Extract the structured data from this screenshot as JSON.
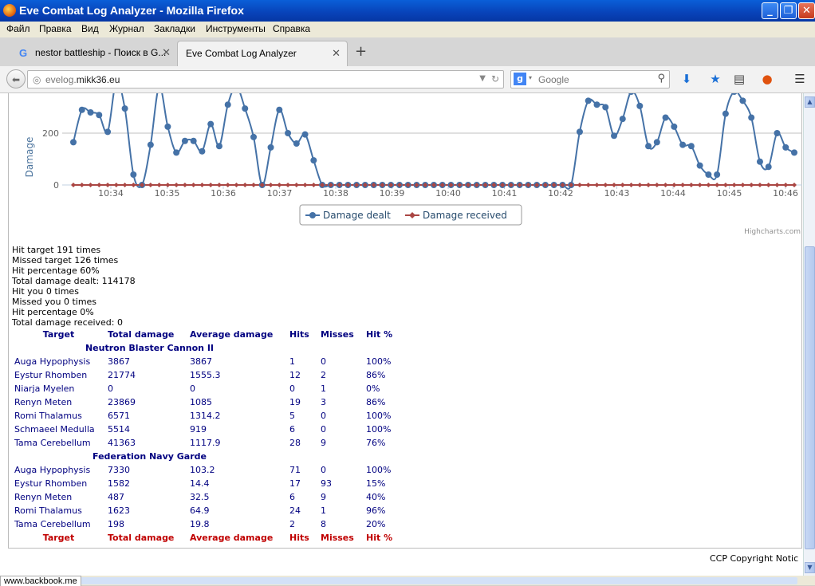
{
  "window": {
    "title": "Eve Combat Log Analyzer - Mozilla Firefox"
  },
  "menu": [
    "Файл",
    "Правка",
    "Вид",
    "Журнал",
    "Закладки",
    "Инструменты",
    "Справка"
  ],
  "tabs": [
    {
      "label": "nestor battleship - Поиск в G...",
      "icon": "google-g-icon"
    },
    {
      "label": "Eve Combat Log Analyzer"
    }
  ],
  "nav": {
    "url_prefix": "evelog.",
    "url_domain": "mikk36.eu",
    "search_placeholder": "Google"
  },
  "chart": {
    "axis_label": "Damage",
    "credits": "Highcharts.com",
    "legend": [
      "Damage dealt",
      "Damage received"
    ]
  },
  "chart_data": {
    "type": "line",
    "ylabel": "Damage",
    "y_ticks": [
      0,
      200
    ],
    "x_ticks": [
      "10:34",
      "10:35",
      "10:36",
      "10:37",
      "10:38",
      "10:39",
      "10:40",
      "10:41",
      "10:42",
      "10:43",
      "10:44",
      "10:45",
      "10:46"
    ],
    "series": [
      {
        "name": "Damage dealt",
        "color": "#4572A7",
        "values": [
          165,
          290,
          280,
          270,
          205,
          400,
          295,
          40,
          0,
          155,
          380,
          225,
          125,
          170,
          170,
          130,
          235,
          150,
          310,
          380,
          295,
          185,
          0,
          145,
          290,
          200,
          160,
          195,
          95,
          0,
          0,
          0,
          0,
          0,
          0,
          0,
          0,
          0,
          0,
          0,
          0,
          0,
          0,
          0,
          0,
          0,
          0,
          0,
          0,
          0,
          0,
          0,
          0,
          0,
          0,
          0,
          0,
          0,
          0,
          205,
          325,
          310,
          300,
          190,
          255,
          360,
          305,
          150,
          165,
          260,
          225,
          155,
          150,
          75,
          40,
          40,
          275,
          360,
          325,
          260,
          90,
          70,
          200,
          145,
          125
        ]
      },
      {
        "name": "Damage received",
        "color": "#AA4643",
        "values": [
          0,
          0,
          0,
          0,
          0,
          0,
          0,
          0,
          0,
          0,
          0,
          0,
          0,
          0,
          0,
          0,
          0,
          0,
          0,
          0,
          0,
          0,
          0,
          0,
          0,
          0,
          0,
          0,
          0,
          0,
          0,
          0,
          0,
          0,
          0,
          0,
          0,
          0,
          0,
          0,
          0,
          0,
          0,
          0,
          0,
          0,
          0,
          0,
          0,
          0,
          0,
          0,
          0,
          0,
          0,
          0,
          0,
          0,
          0,
          0,
          0,
          0,
          0,
          0,
          0,
          0,
          0,
          0,
          0,
          0,
          0,
          0,
          0,
          0,
          0,
          0,
          0,
          0,
          0,
          0,
          0,
          0,
          0,
          0,
          0
        ]
      }
    ]
  },
  "stats": [
    "Hit target 191 times",
    "Missed target 126 times",
    "Hit percentage 60%",
    "Total damage dealt: 114178",
    "Hit you 0 times",
    "Missed you 0 times",
    "Hit percentage 0%",
    "Total damage received: 0"
  ],
  "table": {
    "headers": [
      "Target",
      "Total damage",
      "Average damage",
      "Hits",
      "Misses",
      "Hit %"
    ],
    "groups": [
      {
        "weapon": "Neutron Blaster Cannon II",
        "rows": [
          [
            "Auga Hypophysis",
            "3867",
            "3867",
            "1",
            "0",
            "100%"
          ],
          [
            "Eystur Rhomben",
            "21774",
            "1555.3",
            "12",
            "2",
            "86%"
          ],
          [
            "Niarja Myelen",
            "0",
            "0",
            "0",
            "1",
            "0%"
          ],
          [
            "Renyn Meten",
            "23869",
            "1085",
            "19",
            "3",
            "86%"
          ],
          [
            "Romi Thalamus",
            "6571",
            "1314.2",
            "5",
            "0",
            "100%"
          ],
          [
            "Schmaeel Medulla",
            "5514",
            "919",
            "6",
            "0",
            "100%"
          ],
          [
            "Tama Cerebellum",
            "41363",
            "1117.9",
            "28",
            "9",
            "76%"
          ]
        ]
      },
      {
        "weapon": "Federation Navy Garde",
        "rows": [
          [
            "Auga Hypophysis",
            "7330",
            "103.2",
            "71",
            "0",
            "100%"
          ],
          [
            "Eystur Rhomben",
            "1582",
            "14.4",
            "17",
            "93",
            "15%"
          ],
          [
            "Renyn Meten",
            "487",
            "32.5",
            "6",
            "9",
            "40%"
          ],
          [
            "Romi Thalamus",
            "1623",
            "64.9",
            "24",
            "1",
            "96%"
          ],
          [
            "Tama Cerebellum",
            "198",
            "19.8",
            "2",
            "8",
            "20%"
          ]
        ]
      }
    ]
  },
  "copyright": "CCP Copyright Notic",
  "status": {
    "url": "www.backbook.me"
  }
}
